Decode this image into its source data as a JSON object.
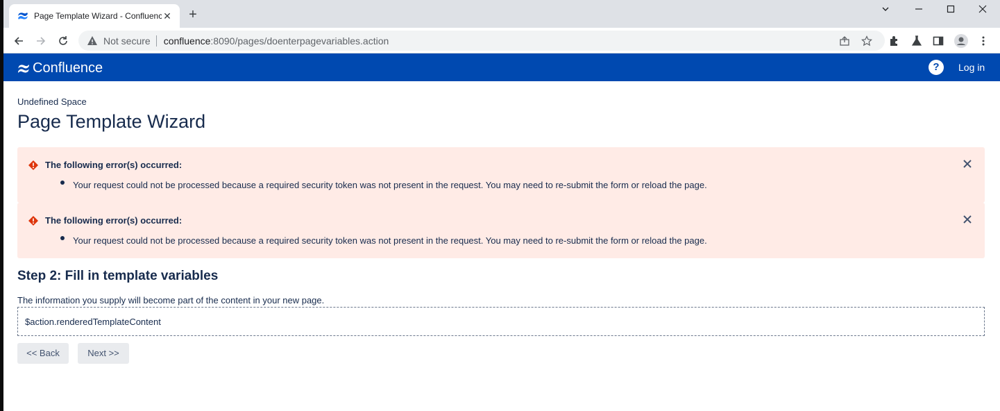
{
  "browser": {
    "tab_title": "Page Template Wizard - Confluence",
    "tab_close": "✕",
    "new_tab": "+",
    "security_label": "Not secure",
    "url_host": "confluence",
    "url_path": ":8090/pages/doenterpagevariables.action"
  },
  "header": {
    "product_name": "Confluence",
    "help_label": "?",
    "login_label": "Log in",
    "brand_color": "#0049b0"
  },
  "page": {
    "space_name": "Undefined Space",
    "title": "Page Template Wizard"
  },
  "errors": [
    {
      "heading": "The following error(s) occurred:",
      "message": "Your request could not be processed because a required security token was not present in the request. You may need to re-submit the form or reload the page."
    },
    {
      "heading": "The following error(s) occurred:",
      "message": "Your request could not be processed because a required security token was not present in the request. You may need to re-submit the form or reload the page."
    }
  ],
  "wizard": {
    "step_title": "Step 2: Fill in template variables",
    "description": "The information you supply will become part of the content in your new page.",
    "template_content": "$action.renderedTemplateContent",
    "back_label": "<< Back",
    "next_label": "Next >>"
  }
}
